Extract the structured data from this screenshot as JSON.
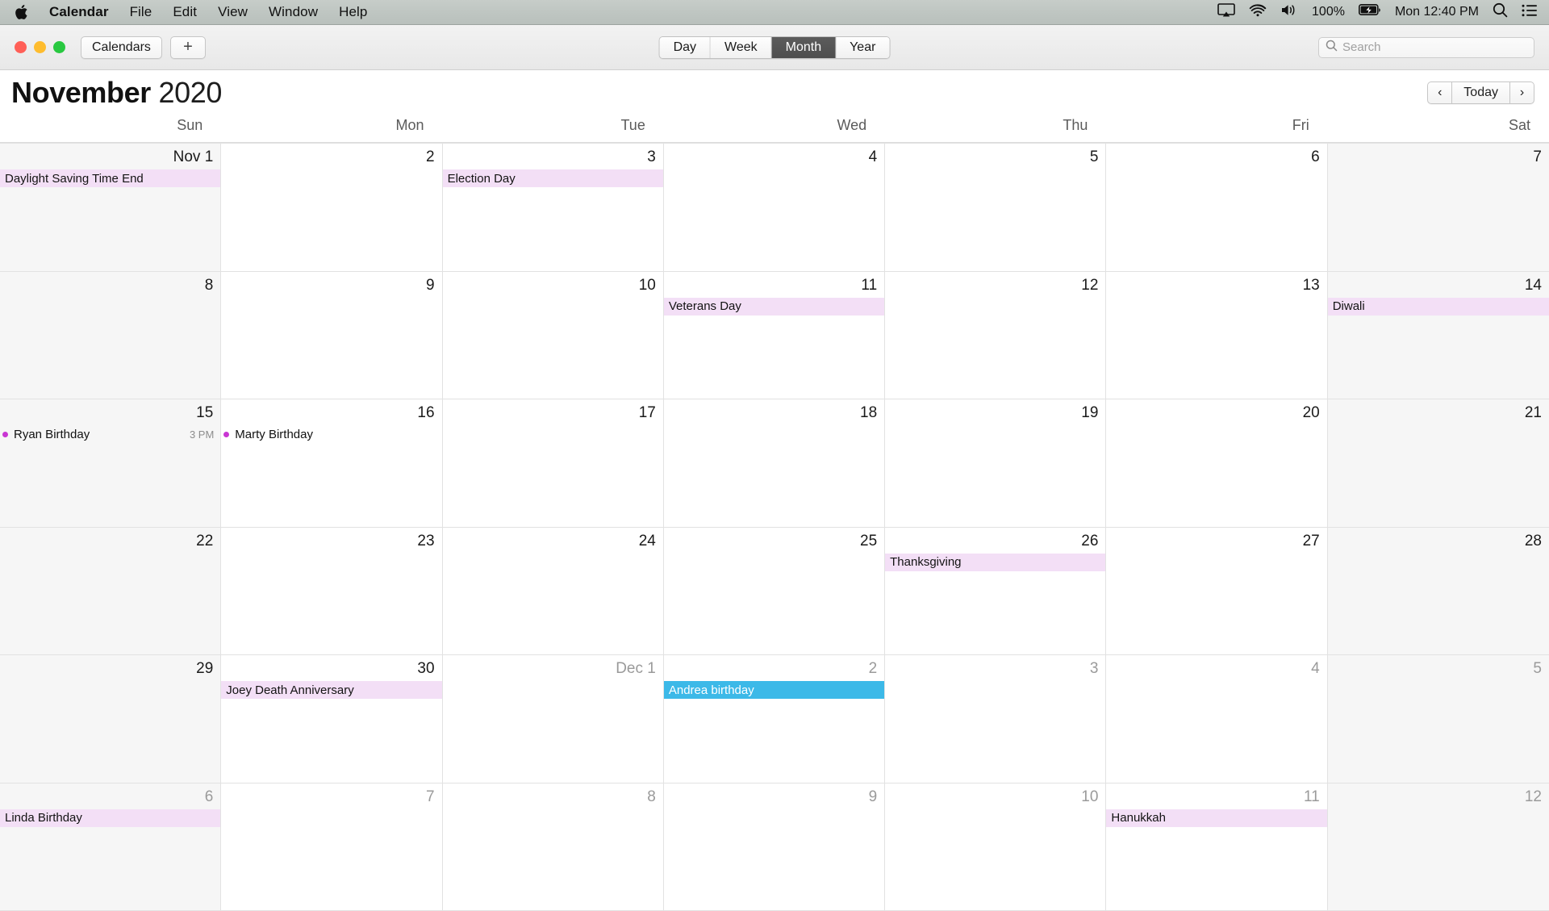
{
  "menubar": {
    "app_name": "Calendar",
    "items": [
      "File",
      "Edit",
      "View",
      "Window",
      "Help"
    ],
    "battery_percent": "100%",
    "clock": "Mon 12:40 PM",
    "icons": [
      "airplay-icon",
      "wifi-icon",
      "volume-icon",
      "battery-icon",
      "spotlight-icon",
      "control-center-icon"
    ]
  },
  "toolbar": {
    "calendars_label": "Calendars",
    "add_label": "+",
    "views": [
      {
        "label": "Day",
        "active": false
      },
      {
        "label": "Week",
        "active": false
      },
      {
        "label": "Month",
        "active": true
      },
      {
        "label": "Year",
        "active": false
      }
    ],
    "search_placeholder": "Search",
    "search_value": ""
  },
  "header": {
    "month": "November",
    "year": "2020",
    "prev_label": "‹",
    "today_label": "Today",
    "next_label": "›"
  },
  "weekdays": [
    "Sun",
    "Mon",
    "Tue",
    "Wed",
    "Thu",
    "Fri",
    "Sat"
  ],
  "colors": {
    "holiday_event_bg": "#f3dff6",
    "birthday_event_bg": "#3cb9e8",
    "birthday_dot": "#c936d3",
    "weekend_bg": "#f6f6f6",
    "accent_selected_segment": "#4e4e4e"
  },
  "days": [
    {
      "num": "Nov 1",
      "dim": false,
      "weekend": true,
      "events": [
        {
          "title": "Daylight Saving Time End",
          "type": "allday",
          "span": 1
        }
      ]
    },
    {
      "num": "2",
      "dim": false,
      "weekend": false,
      "events": []
    },
    {
      "num": "3",
      "dim": false,
      "weekend": false,
      "events": [
        {
          "title": "Election Day",
          "type": "allday",
          "span": 1
        }
      ]
    },
    {
      "num": "4",
      "dim": false,
      "weekend": false,
      "events": []
    },
    {
      "num": "5",
      "dim": false,
      "weekend": false,
      "events": []
    },
    {
      "num": "6",
      "dim": false,
      "weekend": false,
      "events": []
    },
    {
      "num": "7",
      "dim": false,
      "weekend": true,
      "events": []
    },
    {
      "num": "8",
      "dim": false,
      "weekend": true,
      "events": []
    },
    {
      "num": "9",
      "dim": false,
      "weekend": false,
      "events": []
    },
    {
      "num": "10",
      "dim": false,
      "weekend": false,
      "events": []
    },
    {
      "num": "11",
      "dim": false,
      "weekend": false,
      "events": [
        {
          "title": "Veterans Day",
          "type": "allday",
          "span": 1
        }
      ]
    },
    {
      "num": "12",
      "dim": false,
      "weekend": false,
      "events": []
    },
    {
      "num": "13",
      "dim": false,
      "weekend": false,
      "events": []
    },
    {
      "num": "14",
      "dim": false,
      "weekend": true,
      "events": [
        {
          "title": "Diwali",
          "type": "allday",
          "span": 1
        }
      ]
    },
    {
      "num": "15",
      "dim": false,
      "weekend": true,
      "events": [
        {
          "title": "Ryan Birthday",
          "type": "timed",
          "time": "3 PM"
        }
      ]
    },
    {
      "num": "16",
      "dim": false,
      "weekend": false,
      "events": [
        {
          "title": "Marty Birthday",
          "type": "timed",
          "time": ""
        }
      ]
    },
    {
      "num": "17",
      "dim": false,
      "weekend": false,
      "events": []
    },
    {
      "num": "18",
      "dim": false,
      "weekend": false,
      "events": []
    },
    {
      "num": "19",
      "dim": false,
      "weekend": false,
      "events": []
    },
    {
      "num": "20",
      "dim": false,
      "weekend": false,
      "events": []
    },
    {
      "num": "21",
      "dim": false,
      "weekend": true,
      "events": []
    },
    {
      "num": "22",
      "dim": false,
      "weekend": true,
      "events": []
    },
    {
      "num": "23",
      "dim": false,
      "weekend": false,
      "events": []
    },
    {
      "num": "24",
      "dim": false,
      "weekend": false,
      "events": []
    },
    {
      "num": "25",
      "dim": false,
      "weekend": false,
      "events": []
    },
    {
      "num": "26",
      "dim": false,
      "weekend": false,
      "events": [
        {
          "title": "Thanksgiving",
          "type": "allday",
          "span": 1
        }
      ]
    },
    {
      "num": "27",
      "dim": false,
      "weekend": false,
      "events": []
    },
    {
      "num": "28",
      "dim": false,
      "weekend": true,
      "events": []
    },
    {
      "num": "29",
      "dim": false,
      "weekend": true,
      "events": []
    },
    {
      "num": "30",
      "dim": false,
      "weekend": false,
      "events": [
        {
          "title": "Joey Death Anniversary",
          "type": "allday",
          "span": 1
        }
      ]
    },
    {
      "num": "Dec 1",
      "dim": true,
      "weekend": false,
      "events": []
    },
    {
      "num": "2",
      "dim": true,
      "weekend": false,
      "events": [
        {
          "title": "Andrea birthday",
          "type": "allday",
          "color": "blue",
          "span": 1
        }
      ]
    },
    {
      "num": "3",
      "dim": true,
      "weekend": false,
      "events": []
    },
    {
      "num": "4",
      "dim": true,
      "weekend": false,
      "events": []
    },
    {
      "num": "5",
      "dim": true,
      "weekend": true,
      "events": []
    },
    {
      "num": "6",
      "dim": true,
      "weekend": true,
      "events": [
        {
          "title": "Linda Birthday",
          "type": "allday",
          "span": 1
        }
      ]
    },
    {
      "num": "7",
      "dim": true,
      "weekend": false,
      "events": []
    },
    {
      "num": "8",
      "dim": true,
      "weekend": false,
      "events": []
    },
    {
      "num": "9",
      "dim": true,
      "weekend": false,
      "events": []
    },
    {
      "num": "10",
      "dim": true,
      "weekend": false,
      "events": []
    },
    {
      "num": "11",
      "dim": true,
      "weekend": false,
      "events": [
        {
          "title": "Hanukkah",
          "type": "allday",
          "span": 1
        }
      ]
    },
    {
      "num": "12",
      "dim": true,
      "weekend": true,
      "events": []
    }
  ]
}
